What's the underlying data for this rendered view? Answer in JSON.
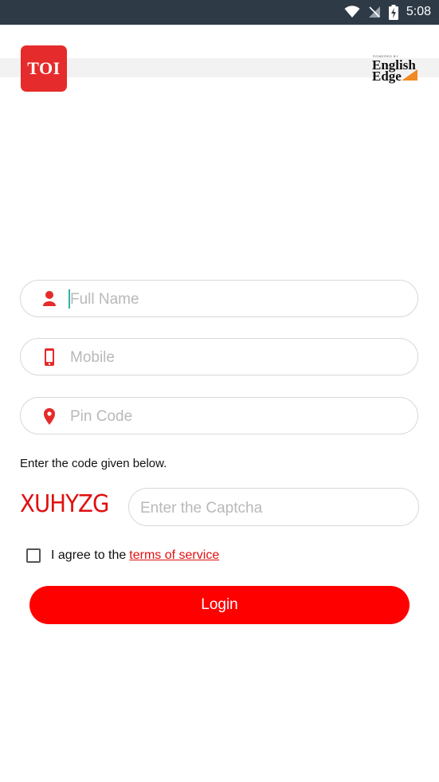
{
  "status_bar": {
    "time": "5:08",
    "icons": [
      "wifi-icon",
      "no-signal-icon",
      "battery-charging-icon"
    ]
  },
  "header": {
    "app_logo_text": "TOI",
    "partner_logo": {
      "powered_by": "POWERED BY",
      "line1": "English",
      "line2": "Edge"
    }
  },
  "form": {
    "full_name": {
      "placeholder": "Full Name",
      "value": "",
      "icon": "person-icon"
    },
    "mobile": {
      "placeholder": "Mobile",
      "value": "",
      "icon": "mobile-phone-icon"
    },
    "pin_code": {
      "placeholder": "Pin Code",
      "value": "",
      "icon": "location-pin-icon"
    },
    "code_instruction": "Enter the code given below.",
    "captcha_code": "XUHYZG",
    "captcha_input": {
      "placeholder": "Enter the Captcha",
      "value": ""
    },
    "agree_text": "I agree to the",
    "terms_link": "terms of service",
    "agree_checked": false,
    "login_label": "Login"
  },
  "colors": {
    "accent": "#ff0000",
    "status_bar": "#2f3a47",
    "icon_red": "#e52b2b",
    "partner_orange": "#f08a24"
  }
}
